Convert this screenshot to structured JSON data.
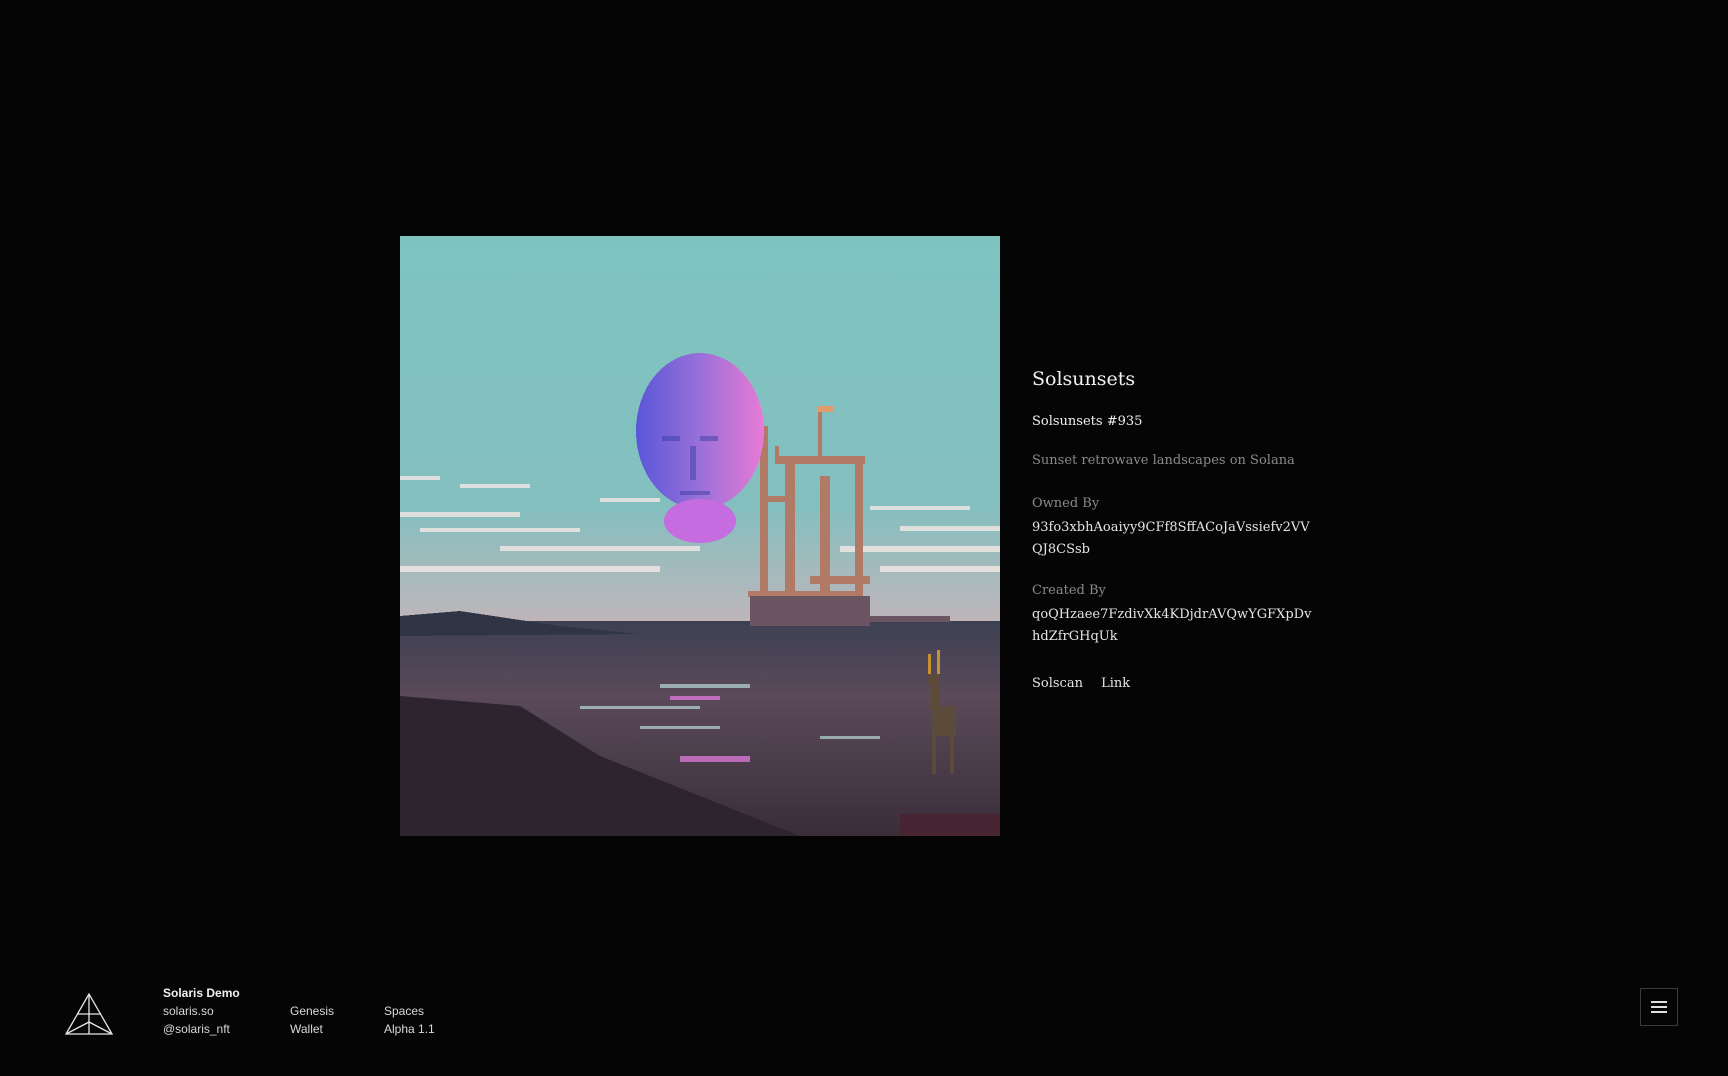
{
  "artwork": {
    "alt": "Solsunsets #935"
  },
  "nft": {
    "collection": "Solsunsets",
    "name": "Solsunsets #935",
    "description": "Sunset retrowave landscapes on Solana",
    "owned_by_label": "Owned By",
    "owned_by": "93fo3xbhAoaiyy9CFf8SffACoJaVssiefv2VVQJ8CSsb",
    "created_by_label": "Created By",
    "created_by": "qoQHzaee7FzdivXk4KDjdrAVQwYGFXpDvhdZfrGHqUk",
    "links": {
      "solscan": "Solscan",
      "link": "Link"
    }
  },
  "footer": {
    "logo_icon": "solaris-tetrahedron-icon",
    "brand": "Solaris Demo",
    "site": "solaris.so",
    "handle": "@solaris_nft",
    "nav_genesis": "Genesis",
    "nav_wallet": "Wallet",
    "nav_spaces": "Spaces",
    "version": "Alpha 1.1",
    "menu_icon": "hamburger-menu-icon"
  },
  "colors": {
    "background": "#050505",
    "sky_top": "#7fc6c3",
    "sky_bottom": "#c9b4b8",
    "accent_pink": "#e27bde",
    "accent_violet": "#7260e3"
  }
}
